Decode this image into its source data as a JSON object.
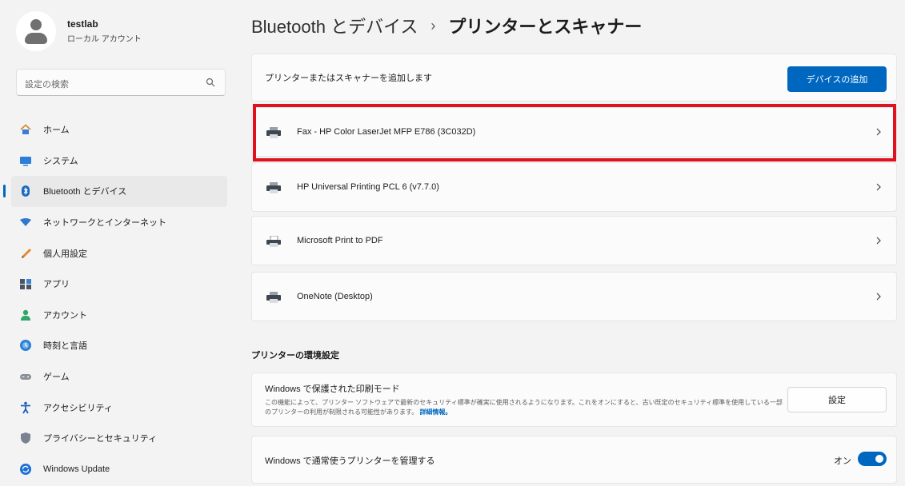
{
  "profile": {
    "name": "testlab",
    "account_type": "ローカル アカウント"
  },
  "search": {
    "placeholder": "設定の検索"
  },
  "nav": {
    "items": [
      {
        "label": "ホーム",
        "icon": "home-icon"
      },
      {
        "label": "システム",
        "icon": "system-icon"
      },
      {
        "label": "Bluetooth とデバイス",
        "icon": "bluetooth-icon",
        "active": true
      },
      {
        "label": "ネットワークとインターネット",
        "icon": "network-icon"
      },
      {
        "label": "個人用設定",
        "icon": "personalization-icon"
      },
      {
        "label": "アプリ",
        "icon": "apps-icon"
      },
      {
        "label": "アカウント",
        "icon": "account-icon"
      },
      {
        "label": "時刻と言語",
        "icon": "time-language-icon"
      },
      {
        "label": "ゲーム",
        "icon": "gaming-icon"
      },
      {
        "label": "アクセシビリティ",
        "icon": "accessibility-icon"
      },
      {
        "label": "プライバシーとセキュリティ",
        "icon": "privacy-shield-icon"
      },
      {
        "label": "Windows Update",
        "icon": "windows-update-icon"
      }
    ]
  },
  "breadcrumb": {
    "parent": "Bluetooth とデバイス",
    "separator": "›",
    "current": "プリンターとスキャナー"
  },
  "add_device": {
    "label": "プリンターまたはスキャナーを追加します",
    "button_label": "デバイスの追加"
  },
  "printers": [
    {
      "name": "Fax - HP Color LaserJet MFP E786 (3C032D)",
      "icon": "printer-icon",
      "highlighted": true
    },
    {
      "name": "HP Universal Printing PCL 6 (v7.7.0)",
      "icon": "printer-icon"
    },
    {
      "name": "Microsoft Print to PDF",
      "icon": "pdf-printer-icon"
    },
    {
      "name": "OneNote (Desktop)",
      "icon": "printer-icon"
    }
  ],
  "preferences": {
    "section_title": "プリンターの環境設定",
    "protected_mode": {
      "title": "Windows で保護された印刷モード",
      "description": "この機能によって、プリンター ソフトウェアで最新のセキュリティ標準が確実に使用されるようになります。これをオンにすると、古い既定のセキュリティ標準を使用している一部のプリンターの利用が制限される可能性があります。",
      "link": "詳細情報。",
      "button_label": "設定"
    },
    "manage_default": {
      "label": "Windows で通常使うプリンターを管理する",
      "toggle_label": "オン",
      "toggle_on": true
    }
  },
  "colors": {
    "accent": "#0067c0",
    "highlight_border": "#e0101e",
    "background": "#f3f3f3",
    "card": "#fbfbfb"
  }
}
